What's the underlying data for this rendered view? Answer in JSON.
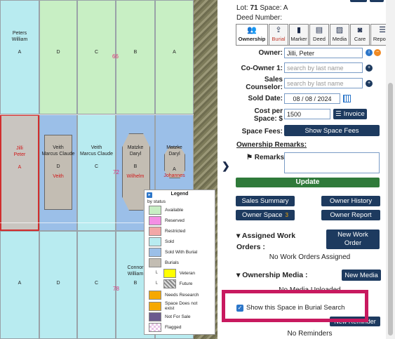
{
  "map": {
    "lots": [
      {
        "name": "Peters\nWilliam",
        "letter": "A"
      },
      {
        "name": "",
        "letter": "D"
      },
      {
        "name": "",
        "letter": "C"
      },
      {
        "name": "",
        "letter": "B"
      },
      {
        "name": "",
        "letter": "A"
      },
      {
        "name": "Jilli\nPeter",
        "letter": "A"
      },
      {
        "name": "Veith\nMarcus Claude",
        "letter": "D",
        "sub": "Veith"
      },
      {
        "name": "Veith\nMarcus Claude",
        "letter": "C"
      },
      {
        "name": "Matzke\nDaryl",
        "letter": "B",
        "sub": "Wilhelm"
      },
      {
        "name": "Matzke\nDaryl",
        "letter": "A",
        "sub": "Johannes"
      },
      {
        "name": "",
        "letter": "A"
      },
      {
        "name": "",
        "letter": "D"
      },
      {
        "name": "",
        "letter": "C"
      },
      {
        "name": "Connor\nWilliam",
        "letter": "B"
      },
      {
        "name": "",
        "letter": "A"
      }
    ],
    "row_numbers": [
      "66",
      "72",
      "78"
    ]
  },
  "legend": {
    "title": "Legend",
    "subtitle": "by status",
    "items": [
      {
        "label": "Available",
        "color": "#c8efc4"
      },
      {
        "label": "Reserved",
        "color": "#f48ee4"
      },
      {
        "label": "Restricted",
        "color": "#f2a7a7"
      },
      {
        "label": "Sold",
        "color": "#b8ebf0"
      },
      {
        "label": "Sold With Burial",
        "color": "#9bbfe8"
      },
      {
        "label": "Burials",
        "color": "#c3bdb3"
      },
      {
        "label": "Veteran",
        "color": "#ffff00"
      },
      {
        "label": "Future",
        "color": "#a8a8a8"
      },
      {
        "label": "Needs Research",
        "color": "#f6a800"
      },
      {
        "label": "Space Does not exist",
        "color": "#f6a800"
      },
      {
        "label": "Not For Sale",
        "color": "#6b5a8e"
      },
      {
        "label": "Flagged",
        "color": "#e8c4e8"
      }
    ]
  },
  "panel": {
    "lot_label": "Lot:",
    "lot_value": "71",
    "space_label": "Space:",
    "space_value": "A",
    "deed_label": "Deed Number:",
    "tabs": [
      {
        "label": "Ownership",
        "icon": "people-icon"
      },
      {
        "label": "Burial",
        "icon": "upload-icon"
      },
      {
        "label": "Marker",
        "icon": "bookmark-icon"
      },
      {
        "label": "Deed",
        "icon": "document-icon"
      },
      {
        "label": "Media",
        "icon": "media-icon"
      },
      {
        "label": "Care",
        "icon": "camera-icon"
      },
      {
        "label": "Reports",
        "icon": "list-icon"
      }
    ],
    "owner_label": "Owner:",
    "owner_value": "Jilli, Peter",
    "coowner_label": "Co-Owner 1:",
    "coowner_placeholder": "search by last name",
    "sales_label": "Sales Counselor:",
    "sales_placeholder": "search by last name",
    "sold_label": "Sold Date:",
    "sold_value": "08 / 08 / 2024",
    "cost_label": "Cost per Space: $",
    "cost_value": "1500",
    "invoice_label": "Invoice",
    "fees_label": "Space Fees:",
    "fees_button": "Show Space Fees",
    "remarks_section": "Ownership Remarks:",
    "remarks_label": "Remarks:",
    "update_button": "Update",
    "sales_summary": "Sales Summary",
    "owner_history": "Owner History",
    "owner_space": "Owner Space",
    "owner_space_count": "3",
    "owner_report": "Owner Report",
    "work_orders_title": "Assigned Work Orders :",
    "new_work_order": "New Work Order",
    "no_work_orders": "No Work Orders Assigned",
    "media_title": "Ownership Media :",
    "new_media": "New Media",
    "no_media": "No Media Uploaded",
    "burial_search_label": "Show this Space in Burial Search",
    "new_reminder": "New Reminder",
    "no_reminders": "No Reminders"
  }
}
